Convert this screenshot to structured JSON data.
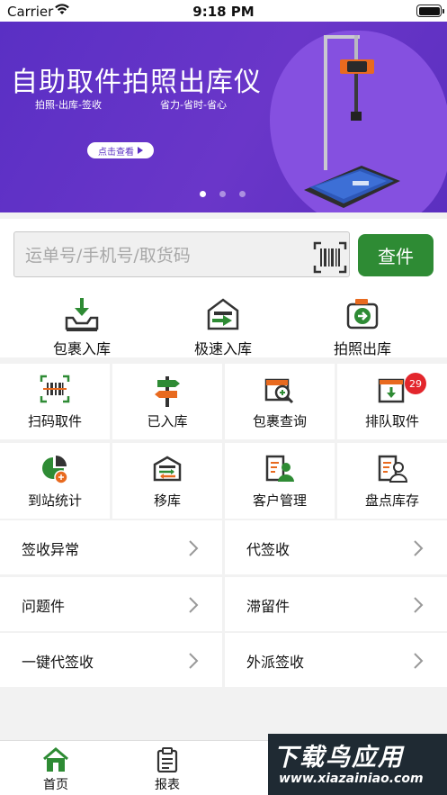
{
  "status_bar": {
    "carrier": "Carrier",
    "time": "9:18 PM"
  },
  "banner": {
    "title": "自助取件拍照出库仪",
    "sub_left": "拍照-出库-签收",
    "sub_right": "省力-省时-省心",
    "button_label": "点击查看",
    "page_indicator": {
      "count": 3,
      "active": 1
    }
  },
  "search": {
    "placeholder": "运单号/手机号/取货码",
    "button_label": "查件",
    "accent_color": "#2e8b34"
  },
  "quick_actions": [
    {
      "label": "包裹入库",
      "icon": "parcel-inbound-icon"
    },
    {
      "label": "极速入库",
      "icon": "fast-inbound-icon"
    },
    {
      "label": "拍照出库",
      "icon": "photo-outbound-icon"
    }
  ],
  "grid": [
    {
      "label": "扫码取件",
      "icon": "barcode-scan-icon"
    },
    {
      "label": "已入库",
      "icon": "signpost-icon"
    },
    {
      "label": "包裹查询",
      "icon": "parcel-search-icon"
    },
    {
      "label": "排队取件",
      "icon": "queue-pickup-icon",
      "badge": "29"
    },
    {
      "label": "到站统计",
      "icon": "pie-chart-icon"
    },
    {
      "label": "移库",
      "icon": "warehouse-move-icon"
    },
    {
      "label": "客户管理",
      "icon": "customer-icon"
    },
    {
      "label": "盘点库存",
      "icon": "inventory-icon"
    }
  ],
  "list": [
    {
      "label": "签收异常"
    },
    {
      "label": "代签收"
    },
    {
      "label": "问题件"
    },
    {
      "label": "滞留件"
    },
    {
      "label": "一键代签收"
    },
    {
      "label": "外派签收"
    }
  ],
  "tab_bar": [
    {
      "label": "首页",
      "icon": "home-icon",
      "active": true
    },
    {
      "label": "报表",
      "icon": "report-icon",
      "active": false
    }
  ],
  "watermark": {
    "line1": "下载鸟应用",
    "line2": "www.xiazainiao.com"
  }
}
